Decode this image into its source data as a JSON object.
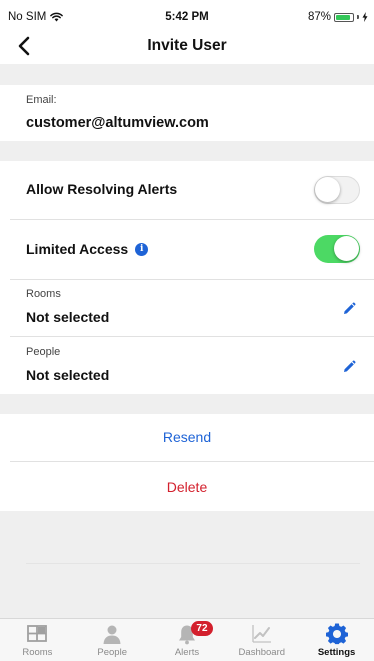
{
  "status_bar": {
    "carrier": "No SIM",
    "time": "5:42 PM",
    "battery": "87%",
    "battery_level": 0.87,
    "battery_color": "#34c759"
  },
  "nav": {
    "title": "Invite User",
    "back_icon": "chevron-left-icon"
  },
  "email": {
    "label": "Email:",
    "value": "customer@altumview.com"
  },
  "settings": {
    "allow_resolving_alerts": {
      "label": "Allow Resolving Alerts",
      "enabled": false
    },
    "limited_access": {
      "label": "Limited Access",
      "enabled": true,
      "info_icon": "info-icon"
    }
  },
  "selections": {
    "rooms": {
      "label": "Rooms",
      "value": "Not selected"
    },
    "people": {
      "label": "People",
      "value": "Not selected"
    }
  },
  "actions": {
    "resend": "Resend",
    "delete": "Delete"
  },
  "tabs": [
    {
      "label": "Rooms",
      "icon": "rooms-grid-icon",
      "active": false
    },
    {
      "label": "People",
      "icon": "person-icon",
      "active": false
    },
    {
      "label": "Alerts",
      "icon": "bell-icon",
      "active": false,
      "badge": "72"
    },
    {
      "label": "Dashboard",
      "icon": "chart-line-icon",
      "active": false
    },
    {
      "label": "Settings",
      "icon": "gear-icon",
      "active": true
    }
  ],
  "colors": {
    "accent_blue": "#1e63d6",
    "danger_red": "#d3202d",
    "toggle_on": "#4cd964"
  }
}
